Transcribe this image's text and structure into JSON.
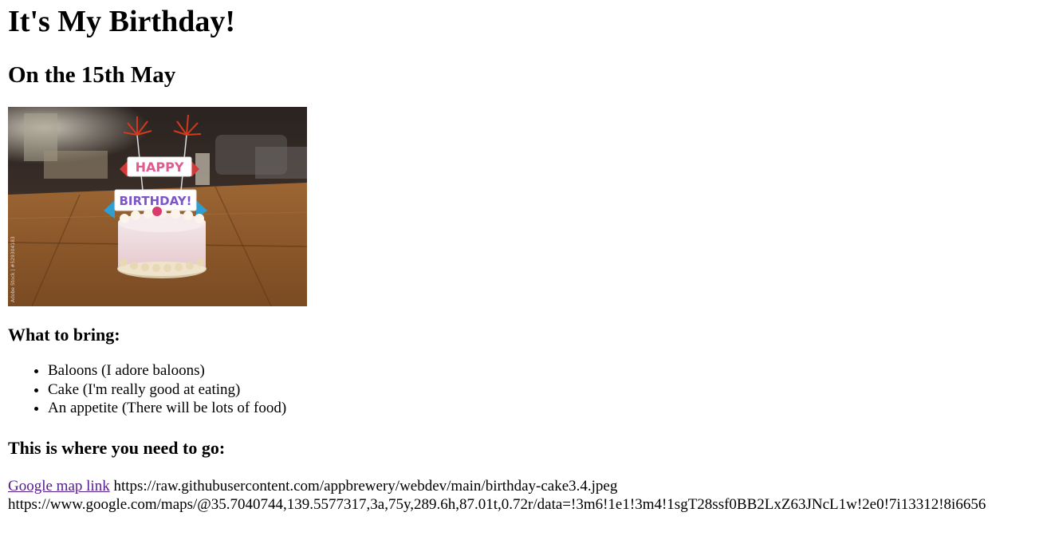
{
  "page": {
    "title": "It's My Birthday!",
    "subtitle": "On the 15th May"
  },
  "image": {
    "topper_top": "HAPPY",
    "topper_bottom": "BIRTHDAY!",
    "watermark": "Adobe Stock | #529304183"
  },
  "bring": {
    "heading": "What to bring:",
    "items": [
      "Baloons (I adore baloons)",
      "Cake (I'm really good at eating)",
      "An appetite (There will be lots of food)"
    ]
  },
  "where": {
    "heading": "This is where you need to go:",
    "link_text": "Google map link",
    "image_url_text": "https://raw.githubusercontent.com/appbrewery/webdev/main/birthday-cake3.4.jpeg",
    "maps_url_text": "https://www.google.com/maps/@35.7040744,139.5577317,3a,75y,289.6h,87.01t,0.72r/data=!3m6!1e1!3m4!1sgT28ssf0BB2LxZ63JNcL1w!2e0!7i13312!8i6656"
  },
  "colors": {
    "link_visited": "#551a8b",
    "text": "#000000",
    "background": "#ffffff"
  }
}
